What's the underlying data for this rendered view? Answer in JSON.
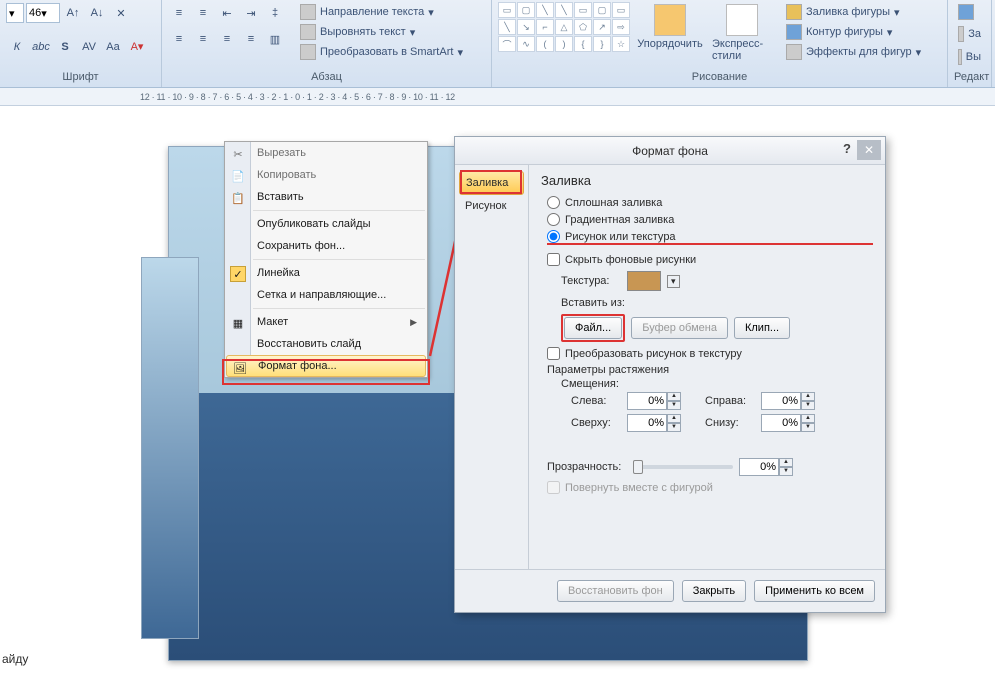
{
  "ribbon": {
    "font": {
      "size": "46",
      "group_label": "Шрифт"
    },
    "paragraph": {
      "group_label": "Абзац",
      "text_direction": "Направление текста",
      "align_text": "Выровнять текст",
      "smartart": "Преобразовать в SmartArt"
    },
    "drawing": {
      "group_label": "Рисование",
      "arrange": "Упорядочить",
      "express_styles": "Экспресс-стили",
      "shape_fill": "Заливка фигуры",
      "shape_outline": "Контур фигуры",
      "shape_effects": "Эффекты для фигур"
    },
    "editing": {
      "group_label": "Редакт",
      "replace": "За",
      "select": "Вы"
    }
  },
  "ruler_text": "12 · 11 · 10 · 9 · 8 · 7 · 6 · 5 · 4 · 3 · 2 · 1 · 0 · 1 · 2 · 3 · 4 · 5 · 6 · 7 · 8 · 9 · 10 · 11 · 12",
  "context_menu": {
    "cut": "Вырезать",
    "copy": "Копировать",
    "paste": "Вставить",
    "publish": "Опубликовать слайды",
    "save_bg": "Сохранить фон...",
    "ruler": "Линейка",
    "grid": "Сетка и направляющие...",
    "layout": "Макет",
    "reset": "Восстановить слайд",
    "format_bg": "Формат фона..."
  },
  "dialog": {
    "title": "Формат фона",
    "side_fill": "Заливка",
    "side_picture": "Рисунок",
    "heading": "Заливка",
    "radio_solid": "Сплошная заливка",
    "radio_gradient": "Градиентная заливка",
    "radio_picture": "Рисунок или текстура",
    "check_hide": "Скрыть фоновые рисунки",
    "texture_label": "Текстура:",
    "insert_from": "Вставить из:",
    "btn_file": "Файл...",
    "btn_clipboard": "Буфер обмена",
    "btn_clip": "Клип...",
    "check_tile": "Преобразовать рисунок в текстуру",
    "stretch_params": "Параметры растяжения",
    "offsets_label": "Смещения:",
    "left_label": "Слева:",
    "right_label": "Справа:",
    "top_label": "Сверху:",
    "bottom_label": "Снизу:",
    "left_val": "0%",
    "right_val": "0%",
    "top_val": "0%",
    "bottom_val": "0%",
    "transparency_label": "Прозрачность:",
    "transparency_val": "0%",
    "check_rotate": "Повернуть вместе с фигурой",
    "btn_reset": "Восстановить фон",
    "btn_close": "Закрыть",
    "btn_apply_all": "Применить ко всем"
  },
  "status": "айду"
}
